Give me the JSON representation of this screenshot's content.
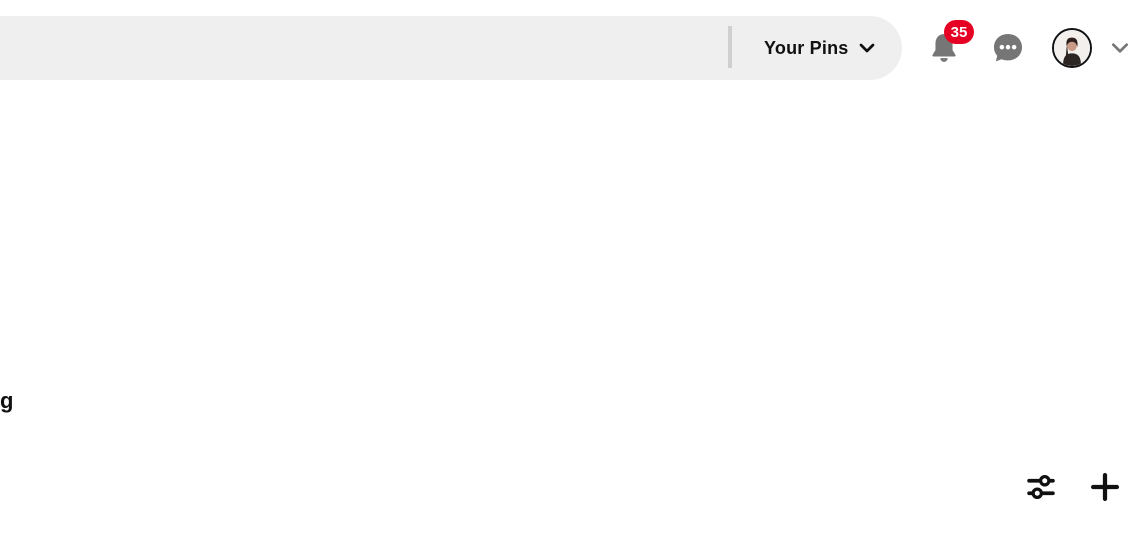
{
  "header": {
    "search": {
      "scope_label": "Your Pins",
      "scope_icon": "chevron-down-icon"
    },
    "notifications": {
      "icon": "bell-icon",
      "badge_count": "35",
      "badge_color": "#e60023"
    },
    "messages": {
      "icon": "chat-bubble-icon"
    },
    "account": {
      "avatar_icon": "avatar",
      "menu_icon": "chevron-down-icon"
    }
  },
  "main": {
    "partial_heading": "g"
  },
  "tools": {
    "filter_icon": "sliders-icon",
    "create_icon": "plus-icon"
  },
  "colors": {
    "search_background": "#efefef",
    "icon_gray": "#767676",
    "text": "#111111"
  }
}
